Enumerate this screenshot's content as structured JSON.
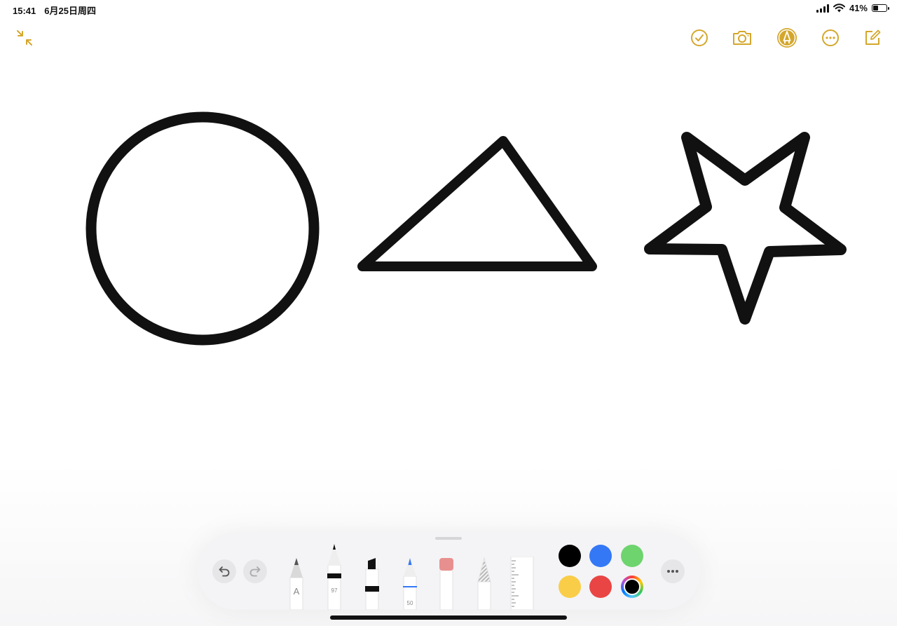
{
  "status": {
    "time": "15:41",
    "date": "6月25日周四",
    "battery": "41%",
    "battery_level": 0.41
  },
  "toolbar": {
    "left_icon": "collapse-arrows-icon",
    "right_icons": [
      "checklist-icon",
      "camera-icon",
      "markup-icon",
      "more-icon",
      "compose-icon"
    ],
    "accent_color": "#D4A72C"
  },
  "palette": {
    "tools": [
      {
        "name": "pencil",
        "label": "A"
      },
      {
        "name": "pen",
        "label": "97"
      },
      {
        "name": "marker",
        "label": ""
      },
      {
        "name": "monoline",
        "label": "50"
      },
      {
        "name": "eraser",
        "label": ""
      },
      {
        "name": "lasso",
        "label": ""
      },
      {
        "name": "ruler",
        "label": ""
      }
    ],
    "colors": [
      "#000000",
      "#3478F6",
      "#6ED46E",
      "#F9CD48",
      "#E94545"
    ],
    "selected_color": "#000000"
  }
}
